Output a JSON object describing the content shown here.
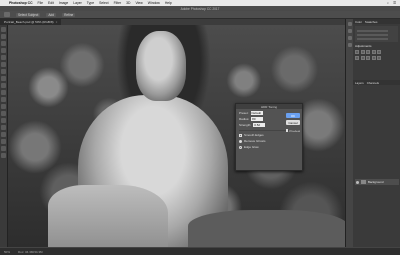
{
  "menubar": {
    "apple": "",
    "app": "Photoshop CC",
    "items": [
      "File",
      "Edit",
      "Image",
      "Layer",
      "Type",
      "Select",
      "Filter",
      "3D",
      "View",
      "Window",
      "Help"
    ],
    "right": [
      "⌕",
      "☰"
    ]
  },
  "app_title": "Adobe Photoshop CC 2017",
  "options": {
    "o1": "Select Subject",
    "o2": "Add",
    "o3": "Refine"
  },
  "tabs": [
    {
      "label": "Portrait_Beach.psd @ 50% (RGB/8)",
      "close": "×"
    }
  ],
  "dialog": {
    "title": "HDR Toning",
    "method_label": "Preset:",
    "method_value": "Default",
    "radius_label": "Radius:",
    "radius_value": "80",
    "strength_label": "Strength:",
    "strength_value": "0.52",
    "ok": "OK",
    "cancel": "Cancel",
    "preview": "Preview",
    "opt1": "Smooth Edges",
    "opt2": "Remove Ghosts",
    "opt3": "Edge Glow"
  },
  "panels": {
    "tab1": "Color",
    "tab2": "Swatches",
    "adjust_head": "Adjustments",
    "layers_tab": "Layers",
    "channels_tab": "Channels",
    "layer_name": "Background"
  },
  "status": {
    "zoom": "50%",
    "doc": "Doc: 34.3M/34.3M"
  }
}
